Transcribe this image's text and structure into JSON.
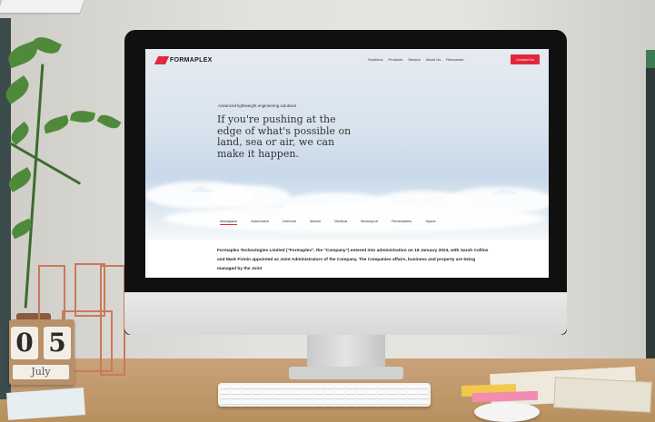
{
  "site": {
    "brand": "FORMAPLEX",
    "nav": [
      "Solutions",
      "Products",
      "Sectors",
      "About Us",
      "Resources"
    ],
    "cta": "Contact Us",
    "hero": {
      "eyebrow": "Advanced lightweight engineering solutions",
      "title": "If you're pushing at the edge of what's possible on land, sea or air, we can make it happen."
    },
    "sectors": [
      "Aerospace",
      "Automotive",
      "Defence",
      "Marine",
      "Medical",
      "Motorsport",
      "Renewables",
      "Space"
    ],
    "notice": "Formaplex Technologies Limited (\"Formaplex\", the \"Company\") entered into administration on 18 January 2024, with Sarah Collins and Mark Firmin appointed as Joint Administrators of the Company. The Companies affairs, business and property are being managed by the Joint"
  },
  "calendar": {
    "day_tens": "0",
    "day_ones": "5",
    "month": "July"
  },
  "colors": {
    "accent": "#e3273a",
    "bezel": "#111111"
  }
}
